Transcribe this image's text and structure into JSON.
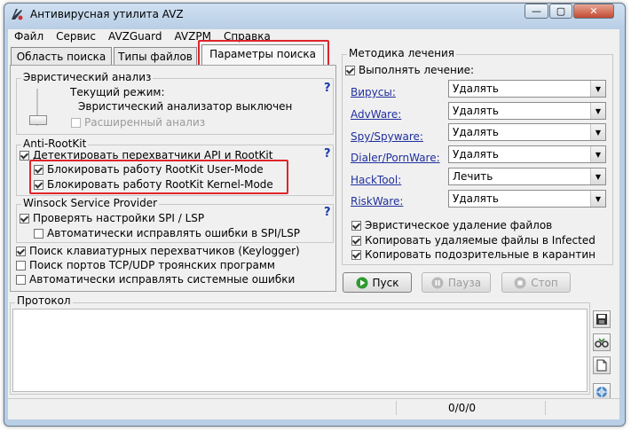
{
  "window": {
    "title": "Антивирусная утилита AVZ"
  },
  "menu": [
    "Файл",
    "Сервис",
    "AVZGuard",
    "AVZPM",
    "Справка"
  ],
  "tabs": [
    "Область поиска",
    "Типы файлов",
    "Параметры поиска"
  ],
  "heuristic": {
    "title": "Эвристический анализ",
    "mode_label": "Текущий режим:",
    "mode_value": "Эвристический анализатор выключен",
    "extended": "Расширенный анализ",
    "help": "?"
  },
  "antirootkit": {
    "title": "Anti-RootKit",
    "detect": "Детектировать перехватчики API и RootKit",
    "block_user": "Блокировать работу RootKit User-Mode",
    "block_kernel": "Блокировать работу RootKit Kernel-Mode",
    "help": "?"
  },
  "winsock": {
    "title": "Winsock  Service Provider",
    "check": "Проверять настройки SPI / LSP",
    "autofix": "Автоматически исправлять ошибки в SPI/LSP",
    "help": "?"
  },
  "options": [
    {
      "label": "Поиск клавиатурных перехватчиков (Keylogger)",
      "checked": true
    },
    {
      "label": "Поиск портов TCP/UDP троянских программ",
      "checked": false
    },
    {
      "label": "Автоматически исправлять системные ошибки",
      "checked": false
    }
  ],
  "treatment": {
    "title": "Методика лечения",
    "perform": "Выполнять лечение:",
    "rows": [
      {
        "label": "Вирусы:",
        "value": "Удалять"
      },
      {
        "label": "AdvWare:",
        "value": "Удалять"
      },
      {
        "label": "Spy/Spyware:",
        "value": "Удалять"
      },
      {
        "label": "Dialer/PornWare:",
        "value": "Удалять"
      },
      {
        "label": "HackTool:",
        "value": "Лечить"
      },
      {
        "label": "RiskWare:",
        "value": "Удалять"
      }
    ],
    "heuristic_delete": "Эвристическое удаление файлов",
    "copy_infected": "Копировать удаляемые файлы в  Infected",
    "copy_quarantine": "Копировать подозрительные в  карантин"
  },
  "buttons": {
    "start": "Пуск",
    "pause": "Пауза",
    "stop": "Стоп"
  },
  "protocol": {
    "title": "Протокол"
  },
  "status": {
    "counter": "0/0/0"
  }
}
